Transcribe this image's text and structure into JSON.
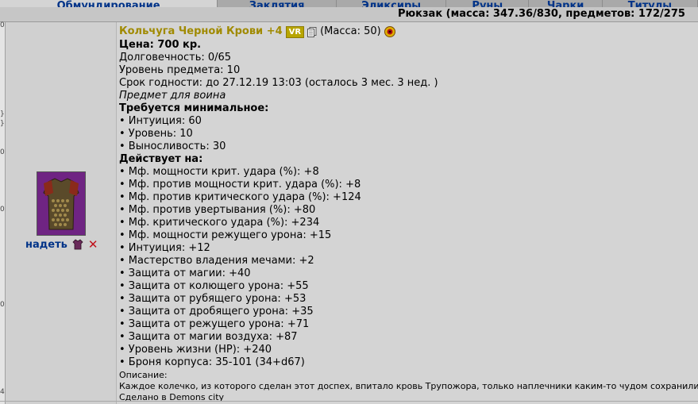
{
  "tabs": [
    {
      "label": "Обмундирование",
      "active": true
    },
    {
      "label": "Заклятия",
      "active": false
    },
    {
      "label": "Эликсиры",
      "active": false
    },
    {
      "label": "Руны",
      "active": false
    },
    {
      "label": "Чарки",
      "active": false
    },
    {
      "label": "Титулы",
      "active": false
    }
  ],
  "header": {
    "backpack": "Рюкзак (масса: 347.36/830, предметов: 172/275"
  },
  "item": {
    "name": "Кольчуга Черной Крови +4",
    "badge": "VR",
    "weight": "(Масса: 50)",
    "price": "Цена: 700 кр.",
    "durability": "Долговечность: 0/65",
    "level": "Уровень предмета: 10",
    "expiry": "Срок годности: до 27.12.19 13:03 (осталось 3 мес. 3 нед. )",
    "class_note": "Предмет для воина",
    "requirements_title": "Требуется минимальное:",
    "requirements": [
      "• Интуиция: 60",
      "• Уровень: 10",
      "• Выносливость: 30"
    ],
    "effects_title": "Действует на:",
    "effects": [
      "• Мф. мощности крит. удара (%): +8",
      "• Мф. против мощности крит. удара (%): +8",
      "• Мф. против критического удара (%): +124",
      "• Мф. против увертывания (%): +80",
      "• Мф. критического удара (%): +234",
      "• Мф. мощности режущего урона: +15",
      "• Интуиция: +12",
      "• Мастерство владения мечами: +2",
      "• Защита от магии: +40",
      "• Защита от колющего урона: +55",
      "• Защита от рубящего урона: +53",
      "• Защита от дробящего урона: +35",
      "• Защита от режущего урона: +71",
      "• Защита от магии воздуха: +87",
      "• Уровень жизни (HP): +240",
      "• Броня корпуса: 35-101 (34+d67)"
    ],
    "description_label": "Описание:",
    "description": "Каждое колечко, из которого сделан этот доспех, впитало кровь Трупожора, только наплечники каким-то чудом сохранили",
    "made_in": "Сделано в Demons city"
  },
  "actions": {
    "wear": "надеть"
  },
  "colors": {
    "item_name": "#a08a00",
    "link": "#003388",
    "delete": "#c0101a",
    "background": "#d4d4d4"
  },
  "icons": [
    "copy-icon",
    "category-icon",
    "dress-icon",
    "delete-icon"
  ]
}
